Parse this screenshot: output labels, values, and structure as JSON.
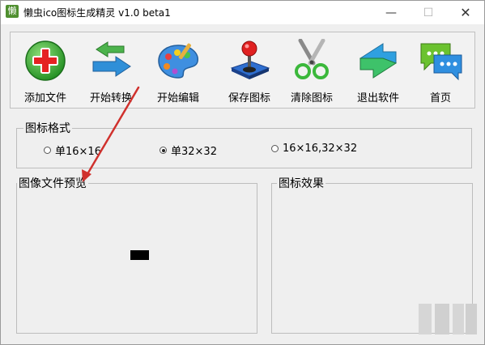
{
  "window": {
    "title": "懒虫ico图标生成精灵 v1.0 beta1",
    "app_icon_char": "懒"
  },
  "window_controls": {
    "minimize": "—",
    "maximize": "☐",
    "close": "✕"
  },
  "toolbar": {
    "buttons": [
      {
        "label": "添加文件",
        "icon": "add-file-icon"
      },
      {
        "label": "开始转换",
        "icon": "convert-arrows-icon"
      },
      {
        "label": "开始编辑",
        "icon": "palette-icon"
      },
      {
        "label": "保存图标",
        "icon": "joystick-icon"
      },
      {
        "label": "清除图标",
        "icon": "scissors-icon"
      },
      {
        "label": "退出软件",
        "icon": "exit-arrow-icon"
      },
      {
        "label": "首页",
        "icon": "chat-bubbles-icon"
      }
    ]
  },
  "icon_format": {
    "title": "图标格式",
    "options": [
      {
        "label": "单16×16",
        "selected": false
      },
      {
        "label": "单32×32",
        "selected": true
      },
      {
        "label": "16×16,32×32",
        "selected": false
      }
    ]
  },
  "preview": {
    "title": "图像文件预览"
  },
  "effect": {
    "title": "图标效果"
  },
  "colors": {
    "annotation_arrow": "#d0312d",
    "window_bg": "#efefef"
  }
}
